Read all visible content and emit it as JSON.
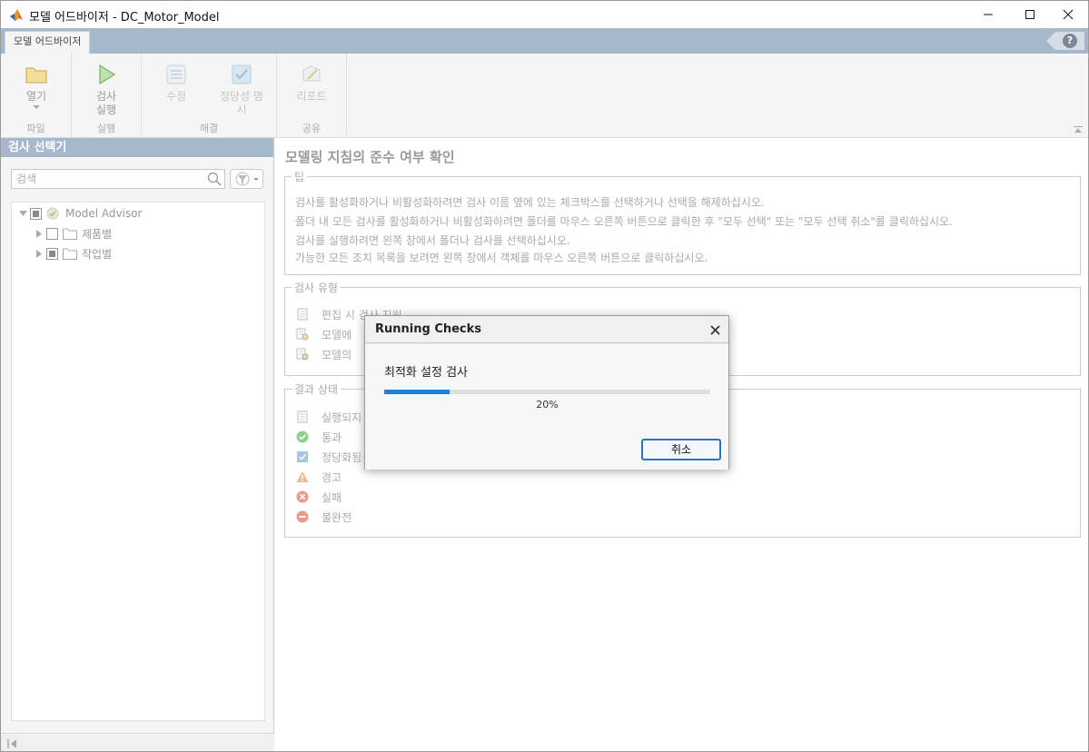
{
  "window": {
    "title": "모델 어드바이저 - DC_Motor_Model"
  },
  "ribbon": {
    "tab_label": "모델 어드바이저",
    "help_label": "?",
    "groups": [
      {
        "label": "파일",
        "buttons": [
          {
            "label": "열기"
          }
        ]
      },
      {
        "label": "실행",
        "buttons": [
          {
            "label_line1": "검사",
            "label_line2": "실행"
          }
        ]
      },
      {
        "label": "해결",
        "buttons": [
          {
            "label": "수정"
          },
          {
            "label_line1": "정당성 명",
            "label_line2": "시"
          }
        ]
      },
      {
        "label": "공유",
        "buttons": [
          {
            "label": "리포트"
          }
        ]
      }
    ]
  },
  "left_pane": {
    "header": "검사 선택기",
    "search_placeholder": "검색",
    "tree": [
      {
        "label": "Model Advisor",
        "level": 0,
        "expanded": true
      },
      {
        "label": "제품별",
        "level": 1,
        "expanded": false
      },
      {
        "label": "작업별",
        "level": 1,
        "expanded": false
      }
    ]
  },
  "main": {
    "title": "모델링 지침의 준수 여부 확인",
    "tips": {
      "legend": "팁",
      "lines": [
        "검사를 활성화하거나 비활성화하려면 검사 이름 옆에 있는 체크박스를 선택하거나 선택을 해제하십시오.",
        "폴더 내 모든 검사를 활성화하거나 비활성화하려면 폴더를 마우스 오른쪽 버튼으로 클릭한 후 \"모두 선택\" 또는 \"모두 선택 취소\"를 클릭하십시오.",
        "검사를 실행하려면 왼쪽 창에서 폴더나 검사를 선택하십시오.",
        "가능한 모든 조치 목록을 보려면 왼쪽 창에서 객체를 마우스 오른쪽 버튼으로 클릭하십시오."
      ]
    },
    "check_types": {
      "legend": "검사 유형",
      "items": [
        "편집 시 검사 지원",
        "모델에",
        "모델의"
      ]
    },
    "result_status": {
      "legend": "결과 상태",
      "items": [
        "실행되지",
        "통과",
        "정당화됨",
        "경고",
        "실패",
        "불완전"
      ]
    }
  },
  "dialog": {
    "title": "Running Checks",
    "task": "최적화 설정 검사",
    "progress": 0.2,
    "progress_label": "20%",
    "cancel_label": "취소"
  },
  "colors": {
    "accent": "#1e7fd6",
    "header_blue": "#a5b8cc",
    "pass_green": "#4caf50",
    "warn_orange": "#e09a5a",
    "fail_red": "#e07b6a"
  }
}
